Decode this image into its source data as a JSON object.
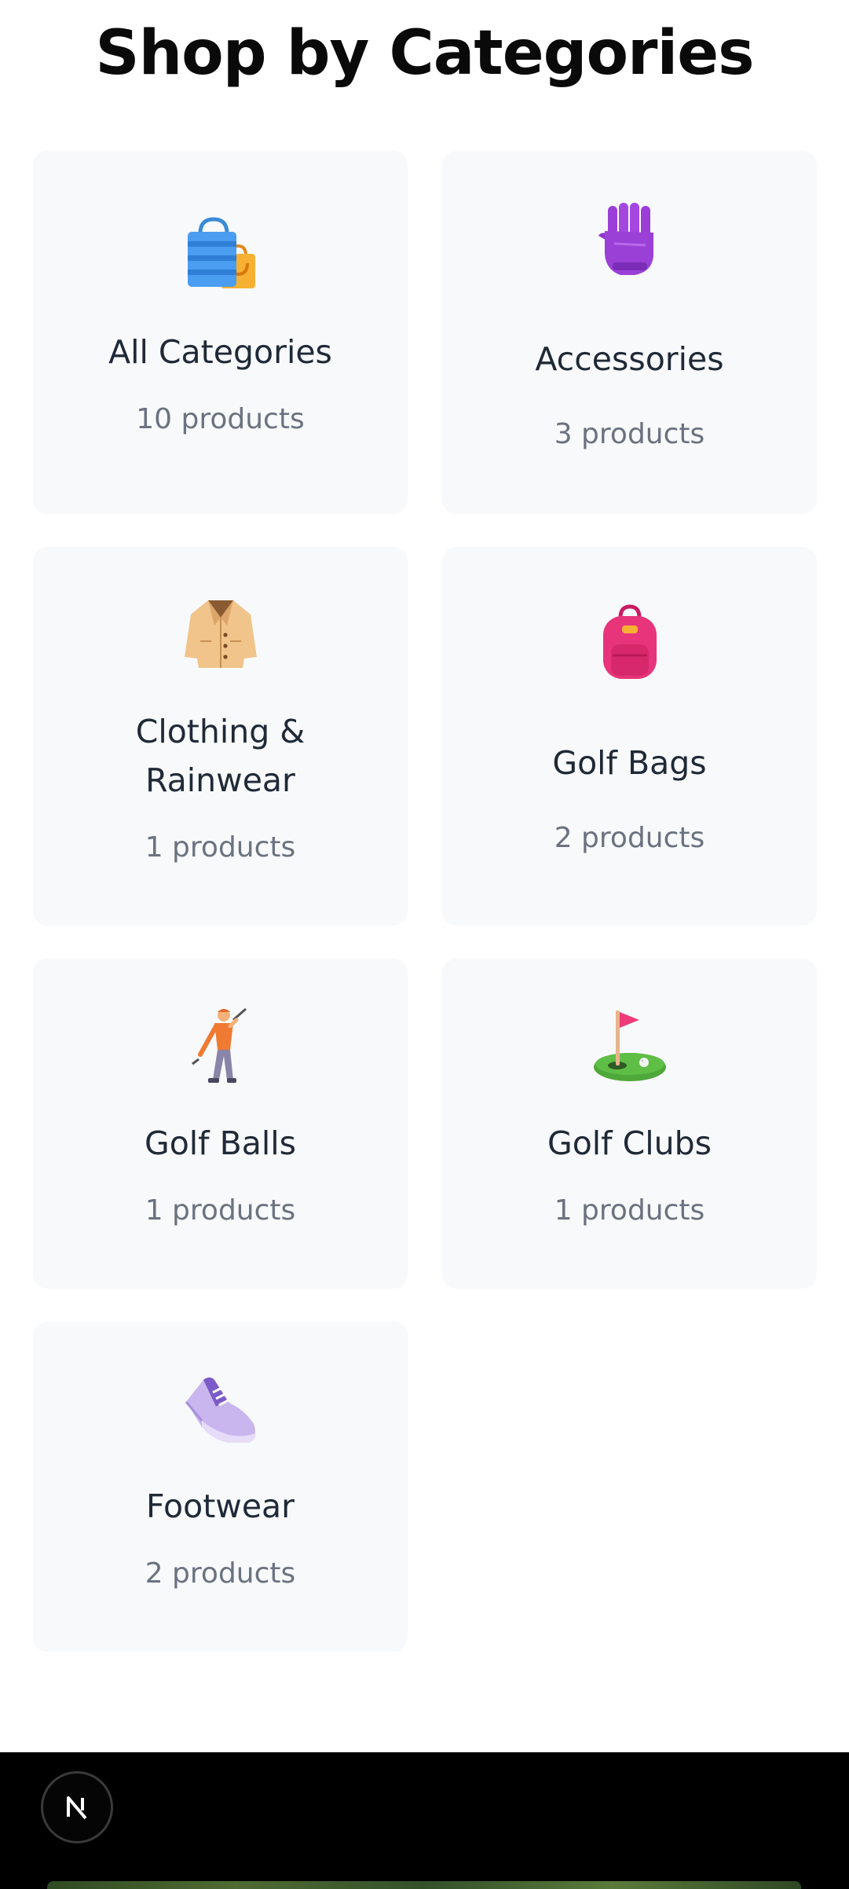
{
  "page": {
    "title": "Shop by Categories"
  },
  "categories": [
    {
      "name": "All Categories",
      "count": "10 products",
      "icon": "shopping-bags-icon"
    },
    {
      "name": "Accessories",
      "count": "3 products",
      "icon": "glove-icon"
    },
    {
      "name": "Clothing & Rainwear",
      "count": "1 products",
      "icon": "coat-icon"
    },
    {
      "name": "Golf Bags",
      "count": "2 products",
      "icon": "backpack-icon"
    },
    {
      "name": "Golf Balls",
      "count": "1 products",
      "icon": "golfer-icon"
    },
    {
      "name": "Golf Clubs",
      "count": "1 products",
      "icon": "flag-in-hole-icon"
    },
    {
      "name": "Footwear",
      "count": "2 products",
      "icon": "sneaker-icon"
    }
  ],
  "footer": {
    "badge_icon": "nextjs-logo-icon"
  },
  "colors": {
    "card_background": "#f8f9fb",
    "name_text": "#1f2937",
    "count_text": "#6b7280",
    "footer_background": "#000000"
  }
}
